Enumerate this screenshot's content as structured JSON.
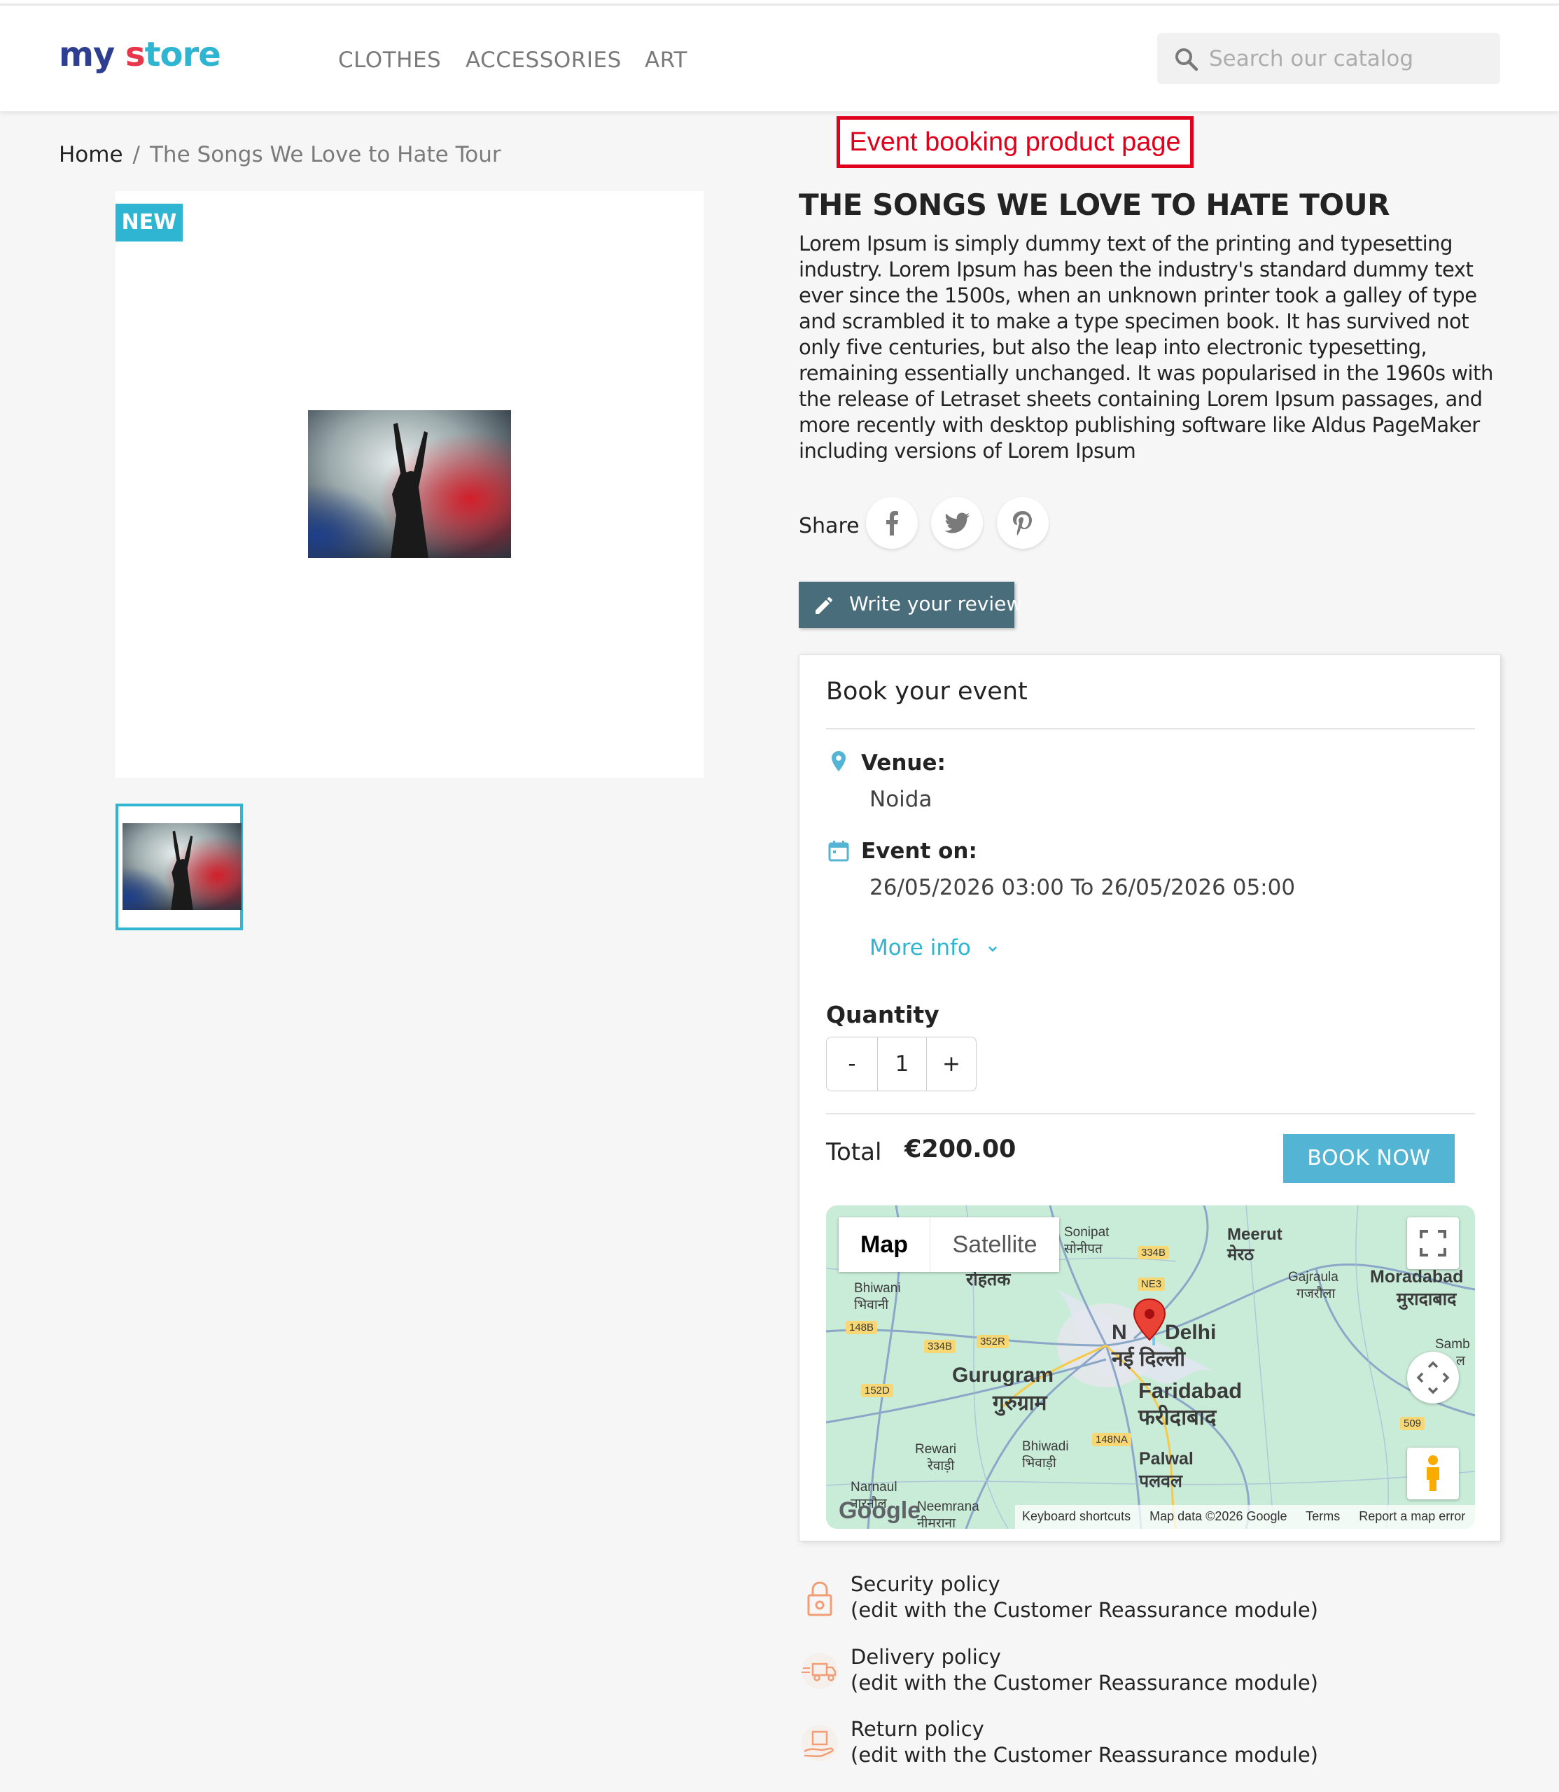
{
  "header": {
    "logo_my": "my",
    "logo_store_s": "s",
    "logo_store_rest": "tore",
    "nav": [
      "CLOTHES",
      "ACCESSORIES",
      "ART"
    ],
    "search_placeholder": "Search our catalog"
  },
  "annotation": "Event booking product page",
  "breadcrumb": {
    "home": "Home",
    "separator": "/",
    "current": "The Songs We Love to Hate Tour"
  },
  "product": {
    "badge": "NEW",
    "title": "THE SONGS WE LOVE TO HATE TOUR",
    "description": "Lorem Ipsum is simply dummy text of the printing and typesetting industry. Lorem Ipsum has been the industry's standard dummy text ever since the 1500s, when an unknown printer took a galley of type and scrambled it to make a type specimen book. It has survived not only five centuries, but also the leap into electronic typesetting, remaining essentially unchanged. It was popularised in the 1960s with the release of Letraset sheets containing Lorem Ipsum passages, and more recently with desktop publishing software like Aldus PageMaker including versions of Lorem Ipsum",
    "share_label": "Share",
    "share_icons": [
      "facebook-icon",
      "twitter-icon",
      "pinterest-icon"
    ],
    "review_button": "Write your review"
  },
  "booking": {
    "title": "Book your event",
    "venue_label": "Venue:",
    "venue_value": "Noida",
    "event_label": "Event on:",
    "event_value": "26/05/2026 03:00 To 26/05/2026 05:00",
    "more_info": "More info",
    "quantity_label": "Quantity",
    "qty_minus": "-",
    "qty_value": "1",
    "qty_plus": "+",
    "total_label": "Total",
    "total_value": "€200.00",
    "book_button": "BOOK NOW"
  },
  "map": {
    "tab_map": "Map",
    "tab_satellite": "Satellite",
    "google": "Google",
    "footer": [
      "Keyboard shortcuts",
      "Map data ©2026 Google",
      "Terms",
      "Report a map error"
    ],
    "places": {
      "sonipat": "Sonipat",
      "sonipat_hi": "सोनीपत",
      "meerut": "Meerut",
      "meerut_hi": "मेरठ",
      "rohtak_hi": "रोहतक",
      "bhiwani": "Bhiwani",
      "bhiwani_hi": "भिवानी",
      "gajraula": "Gajraula",
      "gajraula_hi": "गजरौला",
      "moradabad": "Moradabad",
      "moradabad_hi": "मुरादाबाद",
      "newdelhi_a": "N",
      "newdelhi_b": "Delhi",
      "newdelhi_hi": "नई दिल्ली",
      "gurugram": "Gurugram",
      "gurugram_hi": "गुरुग्राम",
      "faridabad": "Faridabad",
      "faridabad_hi": "फरीदाबाद",
      "rewari": "Rewari",
      "rewari_hi": "रेवाड़ी",
      "bhiwadi": "Bhiwadi",
      "bhiwadi_hi": "भिवाड़ी",
      "palwal": "Palwal",
      "palwal_hi": "पलवल",
      "narnaul": "Narnaul",
      "narnaul_hi": "नारनौल",
      "neemrana": "Neemrana",
      "neemrana_hi": "नीमराना",
      "samb": "Samb",
      "samb2": "ल"
    },
    "roads": [
      "334B",
      "NE3",
      "148B",
      "334B",
      "352R",
      "152D",
      "148NA",
      "509",
      "334B"
    ]
  },
  "reassurance": [
    {
      "title": "Security policy",
      "sub": "(edit with the Customer Reassurance module)"
    },
    {
      "title": "Delivery policy",
      "sub": "(edit with the Customer Reassurance module)"
    },
    {
      "title": "Return policy",
      "sub": "(edit with the Customer Reassurance module)"
    }
  ],
  "colors": {
    "accent": "#2fb5d2",
    "review_button": "#4a6d7c",
    "book_button": "#54b4d3",
    "annotation": "#e0001b"
  }
}
